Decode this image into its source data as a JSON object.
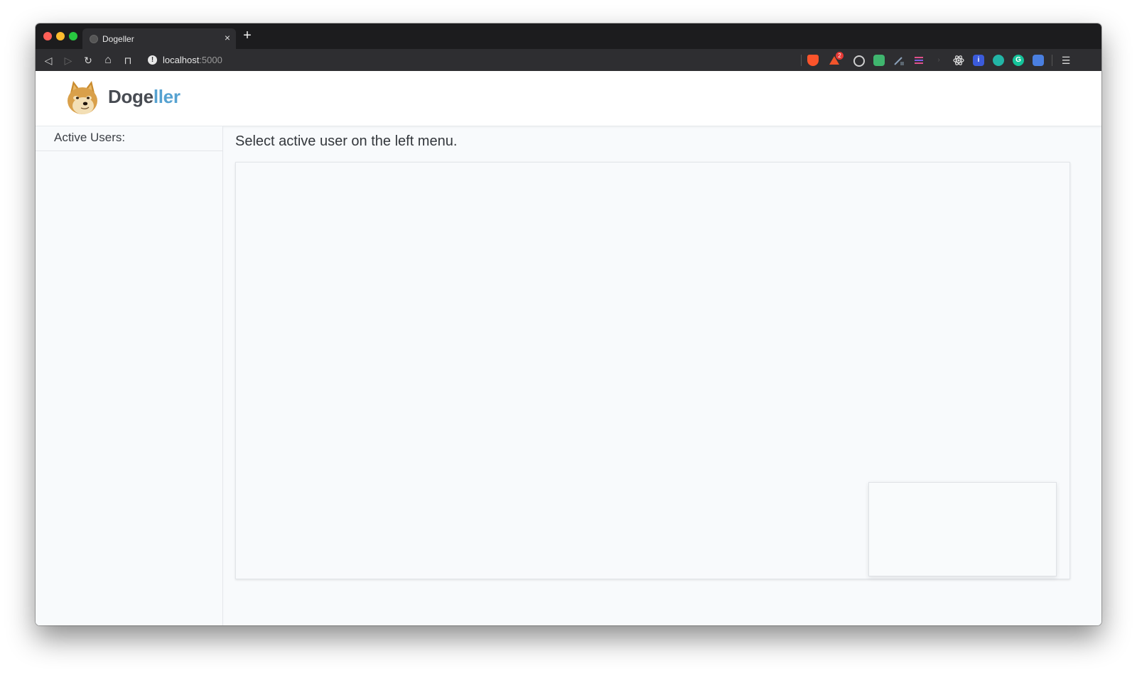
{
  "browser": {
    "tab_title": "Dogeller",
    "tab_close": "×",
    "new_tab": "+",
    "url_host": "localhost",
    "url_port": ":5000",
    "nav": {
      "back": "◁",
      "forward": "▷",
      "reload": "↻",
      "home": "⌂",
      "bookmark": "⊓",
      "menu": "☰"
    },
    "extensions": [
      {
        "icon": "brave-shield-icon",
        "color": "#fb542b"
      },
      {
        "icon": "brave-rewards-icon",
        "color": "#f0542b",
        "badge": "2"
      },
      {
        "icon": "target-icon",
        "color": "#cfcfcf"
      },
      {
        "icon": "chat-extension-icon",
        "color": "#3fb56e"
      },
      {
        "icon": "pen-extension-icon",
        "color": "#8aa0b8"
      },
      {
        "icon": "lines-extension-icon",
        "color": "#e0508a"
      },
      {
        "icon": "arrow-extension-icon",
        "color": "#444444"
      },
      {
        "icon": "react-devtools-icon",
        "color": "#dddddd"
      },
      {
        "icon": "info-extension-icon",
        "color": "#3b5bdb"
      },
      {
        "icon": "teal-circle-extension-icon",
        "color": "#22b5a6"
      },
      {
        "icon": "grammarly-icon",
        "color": "#15c39a"
      },
      {
        "icon": "translate-extension-icon",
        "color": "#4a7fe0"
      }
    ]
  },
  "app": {
    "brand_part1": "Doge",
    "brand_part2": "ller",
    "sidebar_title": "Active Users:",
    "main_title": "Select active user on the left menu."
  }
}
